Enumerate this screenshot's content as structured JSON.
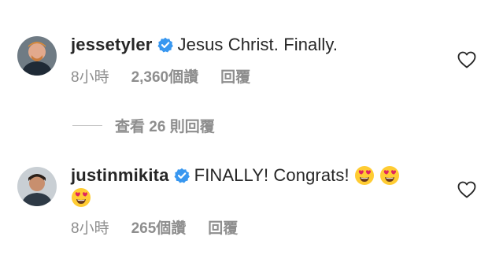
{
  "comments": [
    {
      "username": "jessetyler",
      "text": "Jesus Christ. Finally.",
      "time": "8小時",
      "likes": "2,360個讚",
      "reply": "回覆",
      "verified": true,
      "avatar_icon": "avatar-jessetyler",
      "like_icon": "heart-outline-icon"
    },
    {
      "username": "justinmikita",
      "text": "FINALLY! Congrats!",
      "emoji_icon": "heart-eyes-emoji",
      "time": "8小時",
      "likes": "265個讚",
      "reply": "回覆",
      "verified": true,
      "avatar_icon": "avatar-justinmikita",
      "like_icon": "heart-outline-icon"
    }
  ],
  "view_replies": {
    "label": "查看 26 則回覆"
  },
  "colors": {
    "primary_text": "#262626",
    "secondary_text": "#8e8e8e",
    "verified_blue": "#3897f0",
    "divider": "#c7c7c7"
  }
}
